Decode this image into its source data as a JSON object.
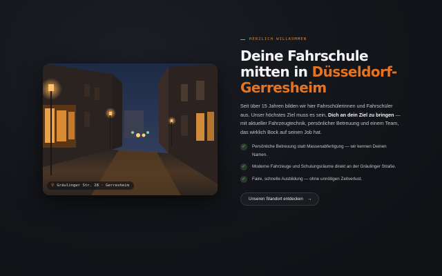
{
  "photo": {
    "alt_icon": "street-photo",
    "location_pin_icon": "map-pin-icon",
    "location_label": "Gräulinger Str. 28 · Gerresheim"
  },
  "hero": {
    "eyebrow": "HERZLICH WILLKOMMEN",
    "title_line1": "Deine Fahrschule",
    "title_line2_prefix": "mitten in ",
    "title_accent_1": "Düsseldorf-",
    "title_accent_2": "Gerresheim",
    "intro_before": "Seit über 15 Jahren bilden wir hier Fahrschülerinnen und Fahrschüler aus. Unser höchstes Ziel muss es sein, ",
    "intro_bold": "Dich an dein Ziel zu bringen",
    "intro_after": " — mit aktueller Fahrzeugtechnik, persönlicher Betreuung und einem Team, das wirklich Bock auf seinen Job hat."
  },
  "features": [
    {
      "icon": "check-icon",
      "text": "Persönliche Betreuung statt Massenabfertigung — wir kennen Deinen Namen."
    },
    {
      "icon": "check-icon",
      "text": "Moderne Fahrzeuge und Schulungsräume direkt an der Gräulinger Straße."
    },
    {
      "icon": "check-icon",
      "text": "Faire, schnelle Ausbildung — ohne unnötigen Zeitverlust."
    }
  ],
  "cta": {
    "label": "Unseren Standort entdecken",
    "arrow": "→"
  },
  "colors": {
    "accent": "#e5731f",
    "check": "#6cc36d",
    "background": "#121419"
  }
}
